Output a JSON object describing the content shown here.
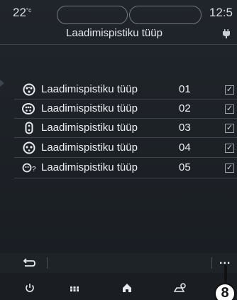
{
  "status_bar": {
    "temperature": "22",
    "temperature_unit": "°c",
    "time": "12:5"
  },
  "header": {
    "title": "Laadimispistiku tüüp"
  },
  "connectors": [
    {
      "icon": "type2-connector-icon",
      "label": "Laadimispistiku tüüp",
      "number": "01",
      "checked": true
    },
    {
      "icon": "combo-ccs-connector-icon",
      "label": "Laadimispistiku tüüp",
      "number": "02",
      "checked": true
    },
    {
      "icon": "chademo-connector-icon",
      "label": "Laadimispistiku tüüp",
      "number": "03",
      "checked": true
    },
    {
      "icon": "type1-connector-icon",
      "label": "Laadimispistiku tüüp",
      "number": "04",
      "checked": true
    },
    {
      "icon": "unknown-connector-icon",
      "label": "Laadimispistiku tüüp",
      "number": "05",
      "checked": true
    }
  ],
  "toolbar": {
    "more_label": "...",
    "callout_number": "8"
  },
  "checkbox_glyph": "✓",
  "colors": {
    "background": "#1b1f24",
    "text": "#e9edf1"
  }
}
